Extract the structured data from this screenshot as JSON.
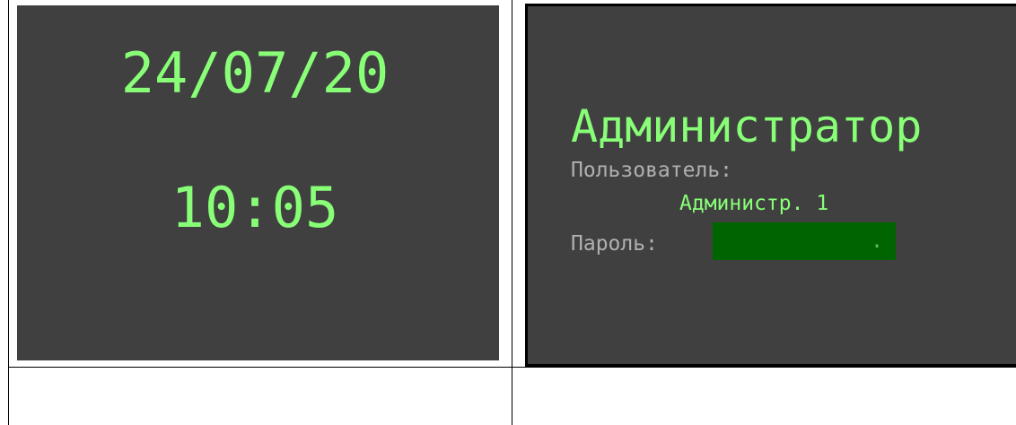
{
  "clock_panel": {
    "date": "24/07/20",
    "time": "10:05"
  },
  "login_panel": {
    "role_title": "Администратор",
    "user_label": "Пользователь:",
    "user_value": "Администр. 1",
    "password_label": "Пароль:",
    "password_value": "."
  },
  "colors": {
    "screen_background": "#404040",
    "primary_text": "#88ff77",
    "secondary_text": "#b0b0b0",
    "password_field_background": "#006400"
  }
}
